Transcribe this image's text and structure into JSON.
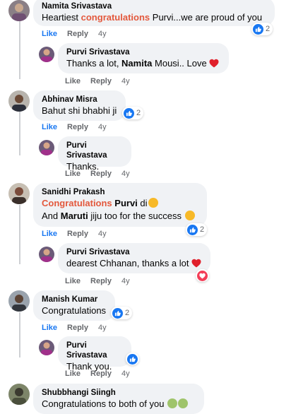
{
  "comments": [
    {
      "author": "Namita Srivastava",
      "text_parts": [
        "Heartiest ",
        "congratulations",
        " Purvi...we are proud of you"
      ],
      "like": "Like",
      "reply": "Reply",
      "age": "4y",
      "reaction_count": "2"
    },
    {
      "author": "Purvi Srivastava",
      "text_parts": [
        "Thanks a lot, ",
        "Namita",
        " Mousi.. Love"
      ],
      "like": "Like",
      "reply": "Reply",
      "age": "4y"
    },
    {
      "author": "Abhinav Misra",
      "text": "Bahut shi bhabhi ji",
      "like": "Like",
      "reply": "Reply",
      "age": "4y",
      "reaction_count": "2"
    },
    {
      "author": "Purvi Srivastava",
      "text": "Thanks.",
      "like": "Like",
      "reply": "Reply",
      "age": "4y"
    },
    {
      "author": "Sanidhi Prakash",
      "line1_parts": [
        "Congratulations",
        " Purvi",
        " di"
      ],
      "line2_parts": [
        "And ",
        "Maruti",
        " jiju too for the success"
      ],
      "like": "Like",
      "reply": "Reply",
      "age": "4y",
      "reaction_count": "2"
    },
    {
      "author": "Purvi Srivastava",
      "text": "dearest Chhanan, thanks a lot",
      "like": "Like",
      "reply": "Reply",
      "age": "4y"
    },
    {
      "author": "Manish Kumar",
      "text": "Congratulations",
      "like": "Like",
      "reply": "Reply",
      "age": "4y",
      "reaction_count": "2"
    },
    {
      "author": "Purvi Srivastava",
      "text": "Thank you.",
      "like": "Like",
      "reply": "Reply",
      "age": "4y"
    },
    {
      "author": "Shubbhangi Siingh",
      "text": "Congratulations to both of you"
    }
  ],
  "colors": {
    "link": "#1877f2",
    "highlight": "#e3583c",
    "bubble": "#f0f2f5",
    "heart": "#f33e58"
  }
}
